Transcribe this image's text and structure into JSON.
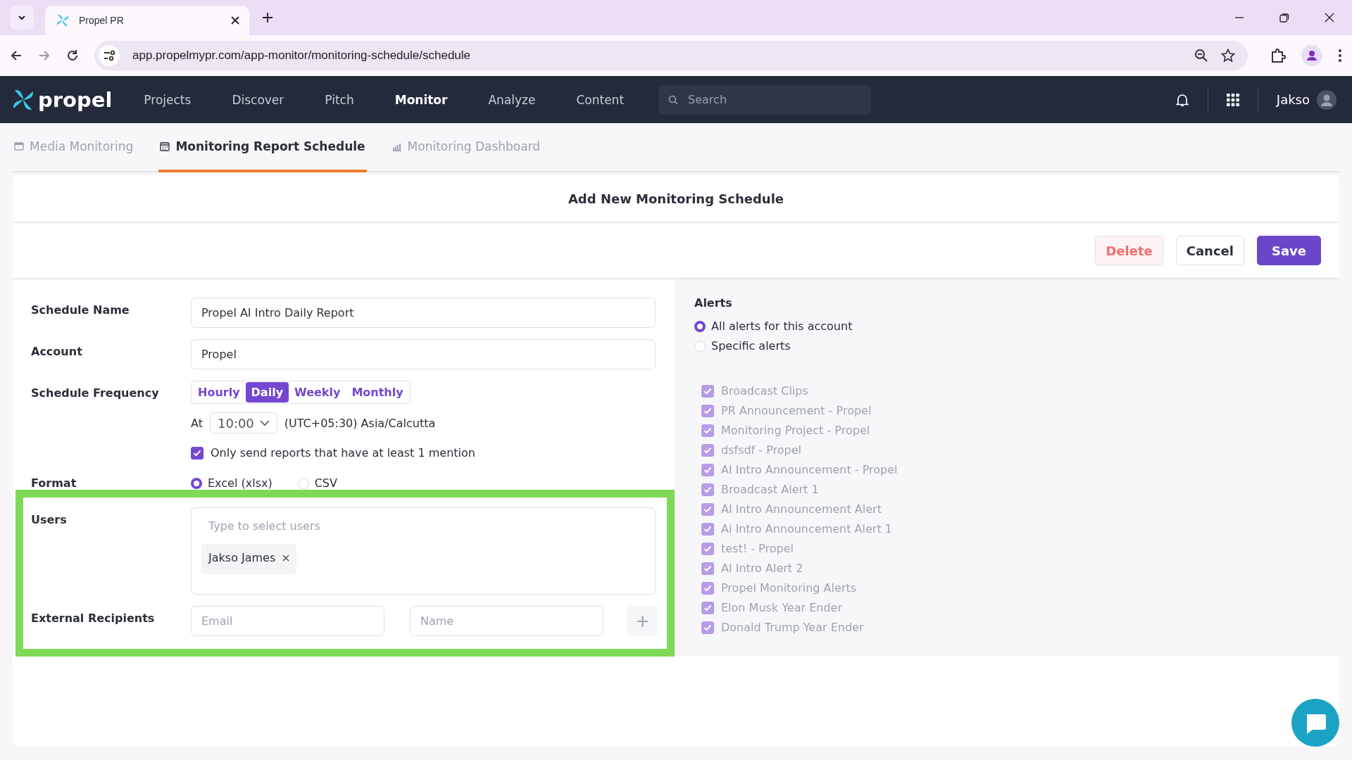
{
  "browser": {
    "tab_title": "Propel PR",
    "url": "app.propelmypr.com/app-monitor/monitoring-schedule/schedule"
  },
  "app_nav": {
    "logo": "propel",
    "items": [
      {
        "label": "Projects",
        "selected": false
      },
      {
        "label": "Discover",
        "selected": false
      },
      {
        "label": "Pitch",
        "selected": false
      },
      {
        "label": "Monitor",
        "selected": true
      },
      {
        "label": "Analyze",
        "selected": false
      },
      {
        "label": "Content",
        "selected": false
      }
    ],
    "search_placeholder": "Search",
    "user": "Jakso"
  },
  "sub_tabs": [
    {
      "label": "Media Monitoring",
      "kind": "media",
      "selected": false
    },
    {
      "label": "Monitoring Report Schedule",
      "kind": "calendar",
      "selected": true
    },
    {
      "label": "Monitoring Dashboard",
      "kind": "chart",
      "selected": false
    }
  ],
  "card": {
    "title": "Add New Monitoring Schedule",
    "buttons": [
      {
        "label": "Delete",
        "kind": "danger"
      },
      {
        "label": "Cancel",
        "kind": "plain"
      },
      {
        "label": "Save",
        "kind": "primary"
      }
    ]
  },
  "form": {
    "schedule_name": {
      "label": "Schedule Name",
      "value": "Propel AI Intro Daily Report"
    },
    "account": {
      "label": "Account",
      "value": "Propel"
    },
    "frequency": {
      "label": "Schedule Frequency",
      "options": [
        {
          "label": "Hourly",
          "selected": false
        },
        {
          "label": "Daily",
          "selected": true
        },
        {
          "label": "Weekly",
          "selected": false
        },
        {
          "label": "Monthly",
          "selected": false
        }
      ],
      "at_label": "At",
      "time": "10:00",
      "timezone": "(UTC+05:30) Asia/Calcutta",
      "min_mention": {
        "label": "Only send reports that have at least 1 mention",
        "checked": true
      }
    },
    "format": {
      "label": "Format",
      "options": [
        {
          "label": "Excel (xlsx)",
          "selected": true
        },
        {
          "label": "CSV",
          "selected": false
        }
      ]
    },
    "users": {
      "label": "Users",
      "placeholder": "Type to select users",
      "chips": [
        "Jakso James"
      ]
    },
    "external": {
      "label": "External Recipients",
      "email_placeholder": "Email",
      "name_placeholder": "Name",
      "add": "+"
    }
  },
  "alerts": {
    "title": "Alerts",
    "scope": [
      {
        "label": "All alerts for this account",
        "selected": true
      },
      {
        "label": "Specific alerts",
        "selected": false
      }
    ],
    "items": [
      {
        "label": "Broadcast Clips",
        "checked": true
      },
      {
        "label": "PR Announcement - Propel",
        "checked": true
      },
      {
        "label": "Monitoring Project - Propel",
        "checked": true
      },
      {
        "label": "dsfsdf - Propel",
        "checked": true
      },
      {
        "label": "AI Intro Announcement - Propel",
        "checked": true
      },
      {
        "label": "Broadcast Alert 1",
        "checked": true
      },
      {
        "label": "AI Intro Announcement Alert",
        "checked": true
      },
      {
        "label": "Ai Intro Announcement Alert 1",
        "checked": true
      },
      {
        "label": "test! - Propel",
        "checked": true
      },
      {
        "label": "AI Intro Alert 2",
        "checked": true
      },
      {
        "label": "Propel Monitoring Alerts",
        "checked": true
      },
      {
        "label": "Elon Musk Year Ender",
        "checked": true
      },
      {
        "label": "Donald Trump Year Ender",
        "checked": true
      }
    ]
  }
}
